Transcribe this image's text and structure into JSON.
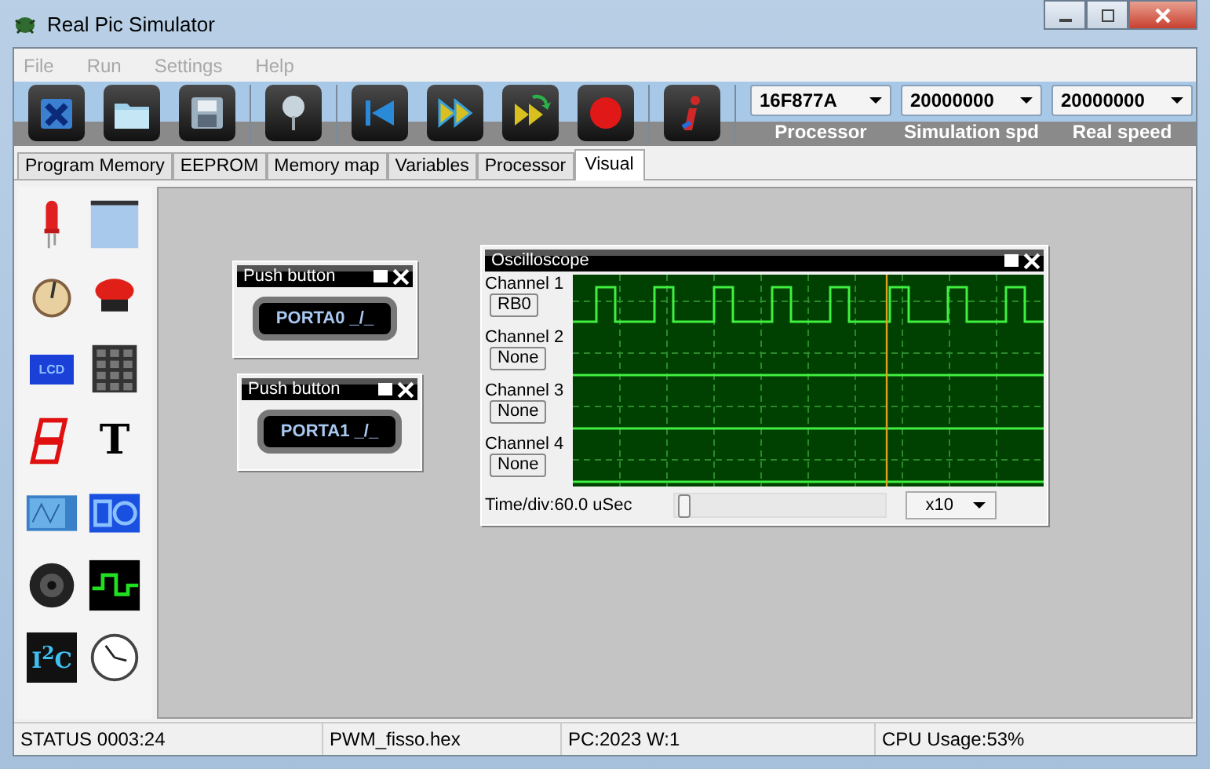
{
  "window": {
    "title": "Real Pic Simulator"
  },
  "menu": [
    {
      "label": "File",
      "disabled": true
    },
    {
      "label": "Run",
      "disabled": true
    },
    {
      "label": "Settings",
      "disabled": true
    },
    {
      "label": "Help",
      "disabled": true
    }
  ],
  "toolbar": [
    {
      "kind": "close-file"
    },
    {
      "kind": "open"
    },
    {
      "kind": "save"
    },
    {
      "kind": "probe"
    },
    {
      "kind": "reset"
    },
    {
      "kind": "run"
    },
    {
      "kind": "step"
    },
    {
      "kind": "stop"
    },
    {
      "kind": "info"
    }
  ],
  "selectors": [
    {
      "value": "16F877A",
      "label": "Processor"
    },
    {
      "value": "20000000",
      "label": "Simulation spd"
    },
    {
      "value": "20000000",
      "label": "Real speed"
    }
  ],
  "tabs": [
    {
      "label": "Program Memory",
      "selected": false
    },
    {
      "label": "EEPROM",
      "selected": false
    },
    {
      "label": "Memory map",
      "selected": false
    },
    {
      "label": "Variables",
      "selected": false
    },
    {
      "label": "Processor",
      "selected": false
    },
    {
      "label": "Visual",
      "selected": true
    }
  ],
  "palette": [
    {
      "kind": "led"
    },
    {
      "kind": "window"
    },
    {
      "kind": "knob"
    },
    {
      "kind": "push"
    },
    {
      "kind": "lcd",
      "label": "LCD"
    },
    {
      "kind": "keypad"
    },
    {
      "kind": "segment"
    },
    {
      "kind": "text",
      "label": "T"
    },
    {
      "kind": "scope"
    },
    {
      "kind": "shapes"
    },
    {
      "kind": "speaker"
    },
    {
      "kind": "signal"
    },
    {
      "kind": "i2c",
      "label": "I$^{2}$C"
    },
    {
      "kind": "clock"
    }
  ],
  "push_buttons": [
    {
      "title": "Push button",
      "label": "PORTA0 _/_"
    },
    {
      "title": "Push button",
      "label": "PORTA1 _/_"
    }
  ],
  "oscilloscope": {
    "title": "Oscilloscope",
    "channels": [
      {
        "name": "Channel 1",
        "source": "RB0"
      },
      {
        "name": "Channel 2",
        "source": "None"
      },
      {
        "name": "Channel 3",
        "source": "None"
      },
      {
        "name": "Channel 4",
        "source": "None"
      }
    ],
    "time_div": "Time/div:60.0 uSec",
    "zoom": {
      "level": 0.02
    },
    "multiplier": "x10"
  },
  "status_bar": [
    "STATUS 0003:24",
    "PWM_fisso.hex",
    "PC:2023 W:1",
    "CPU Usage:53%"
  ]
}
